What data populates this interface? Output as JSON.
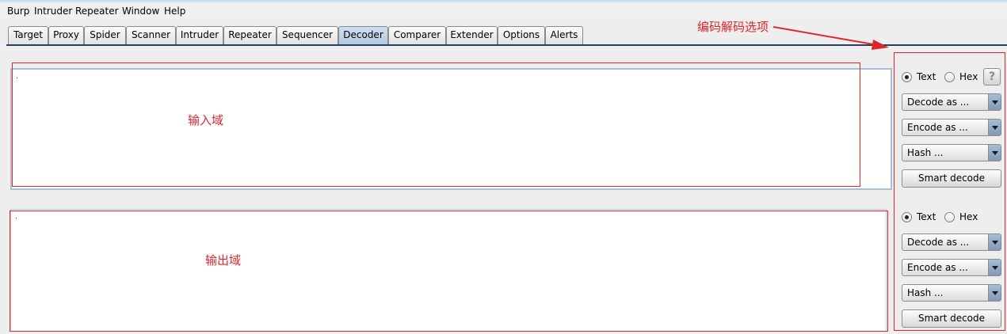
{
  "menu": [
    "Burp",
    "Intruder",
    "Repeater",
    "Window",
    "Help"
  ],
  "tabs": [
    {
      "label": "Target"
    },
    {
      "label": "Proxy"
    },
    {
      "label": "Spider"
    },
    {
      "label": "Scanner"
    },
    {
      "label": "Intruder"
    },
    {
      "label": "Repeater"
    },
    {
      "label": "Sequencer"
    },
    {
      "label": "Decoder",
      "active": true
    },
    {
      "label": "Comparer"
    },
    {
      "label": "Extender"
    },
    {
      "label": "Options"
    },
    {
      "label": "Alerts"
    }
  ],
  "annotations": {
    "options": "编码解码选项",
    "input": "输入域",
    "output": "输出域"
  },
  "panel_in": {
    "text_label": "Text",
    "hex_label": "Hex",
    "selected": "Text",
    "help": "?",
    "decode": "Decode as ...",
    "encode": "Encode as ...",
    "hash": "Hash ...",
    "smart": "Smart decode"
  },
  "panel_out": {
    "text_label": "Text",
    "hex_label": "Hex",
    "selected": "Text",
    "decode": "Decode as ...",
    "encode": "Encode as ...",
    "hash": "Hash ...",
    "smart": "Smart decode"
  },
  "colors": {
    "annotation": "#e0262a",
    "tab_active": "#b8cce2",
    "accent_line": "#2d3e66"
  }
}
